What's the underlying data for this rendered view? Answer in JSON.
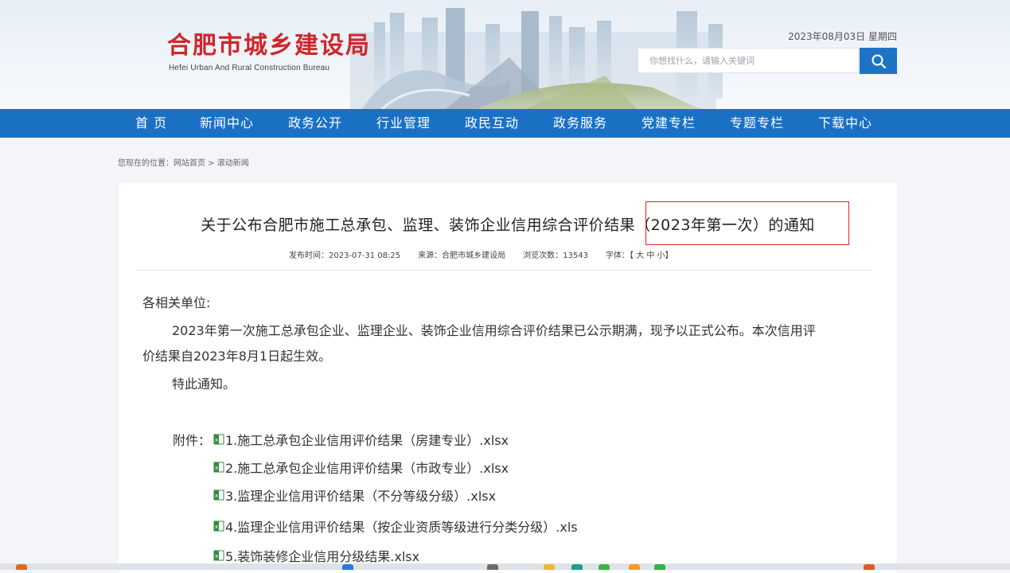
{
  "header": {
    "logo_cn": "合肥市城乡建设局",
    "logo_en": "Hefei Urban And Rural Construction Bureau",
    "date": "2023年08月03日 星期四",
    "search_placeholder": "你想找什么，请输入关键词"
  },
  "nav": {
    "items": [
      {
        "label": "首 页"
      },
      {
        "label": "新闻中心"
      },
      {
        "label": "政务公开"
      },
      {
        "label": "行业管理"
      },
      {
        "label": "政民互动"
      },
      {
        "label": "政务服务"
      },
      {
        "label": "党建专栏"
      },
      {
        "label": "专题专栏"
      },
      {
        "label": "下载中心"
      }
    ]
  },
  "breadcrumb": {
    "prefix": "您现在的位置：",
    "home": "网站首页",
    "sep": " > ",
    "current": "滚动新闻"
  },
  "article": {
    "title_main": "关于公布合肥市施工总承包、监理、装饰企业信用综合评价结果",
    "title_highlight": "（2023年第一次）的通知",
    "meta": {
      "publish_label": "发布时间：",
      "publish_time": "2023-07-31 08:25",
      "source_label": "来源：",
      "source": "合肥市城乡建设局",
      "views_label": "浏览次数：",
      "views": "13543",
      "font_label": "字体：",
      "font_open": "【",
      "font_large": "大",
      "font_medium": "中",
      "font_small": "小",
      "font_close": "】"
    },
    "greeting": "各相关单位:",
    "para1_line1": "2023年第一次施工总承包企业、监理企业、装饰企业信用综合评价结果已公示期满，现予以正式公布。本次信用评",
    "para1_line2": "价结果自2023年8月1日起生效。",
    "closing": "特此通知。",
    "attachments_label": "附件：",
    "attachments": [
      {
        "label": "1.施工总承包企业信用评价结果（房建专业）.xlsx"
      },
      {
        "label": "2.施工总承包企业信用评价结果（市政专业）.xlsx"
      },
      {
        "label": "3.监理企业信用评价结果（不分等级分级）.xlsx"
      },
      {
        "label": "4.监理企业信用评价结果（按企业资质等级进行分类分级）.xls"
      },
      {
        "label": "5.装饰装修企业信用分级结果.xlsx"
      }
    ]
  },
  "colors": {
    "nav_bg": "#1a71c4",
    "logo_red": "#d0262b",
    "highlight_border": "#e02020",
    "search_btn": "#1d74c5"
  },
  "icons": {
    "search": "magnifier-icon",
    "attachment": "excel-file-icon"
  }
}
